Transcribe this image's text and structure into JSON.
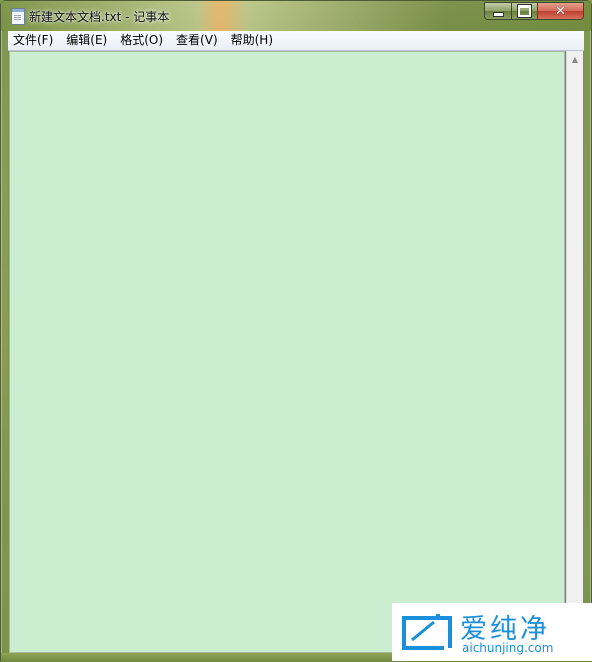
{
  "window": {
    "title": "新建文本文档.txt - 记事本"
  },
  "caption_buttons": {
    "minimize_icon": "minimize-icon",
    "maximize_icon": "maximize-icon",
    "close_icon": "close-icon",
    "close_glyph": "✕"
  },
  "menu": {
    "items": [
      {
        "label": "文件(F)"
      },
      {
        "label": "编辑(E)"
      },
      {
        "label": "格式(O)"
      },
      {
        "label": "查看(V)"
      },
      {
        "label": "帮助(H)"
      }
    ]
  },
  "editor": {
    "content": "",
    "background_color": "#cbedd0"
  },
  "scrollbar": {
    "up_arrow": "▲"
  },
  "watermark": {
    "cn_text": "爱纯净",
    "en_text": "aichunjing.com",
    "color": "#1a8fdb"
  }
}
